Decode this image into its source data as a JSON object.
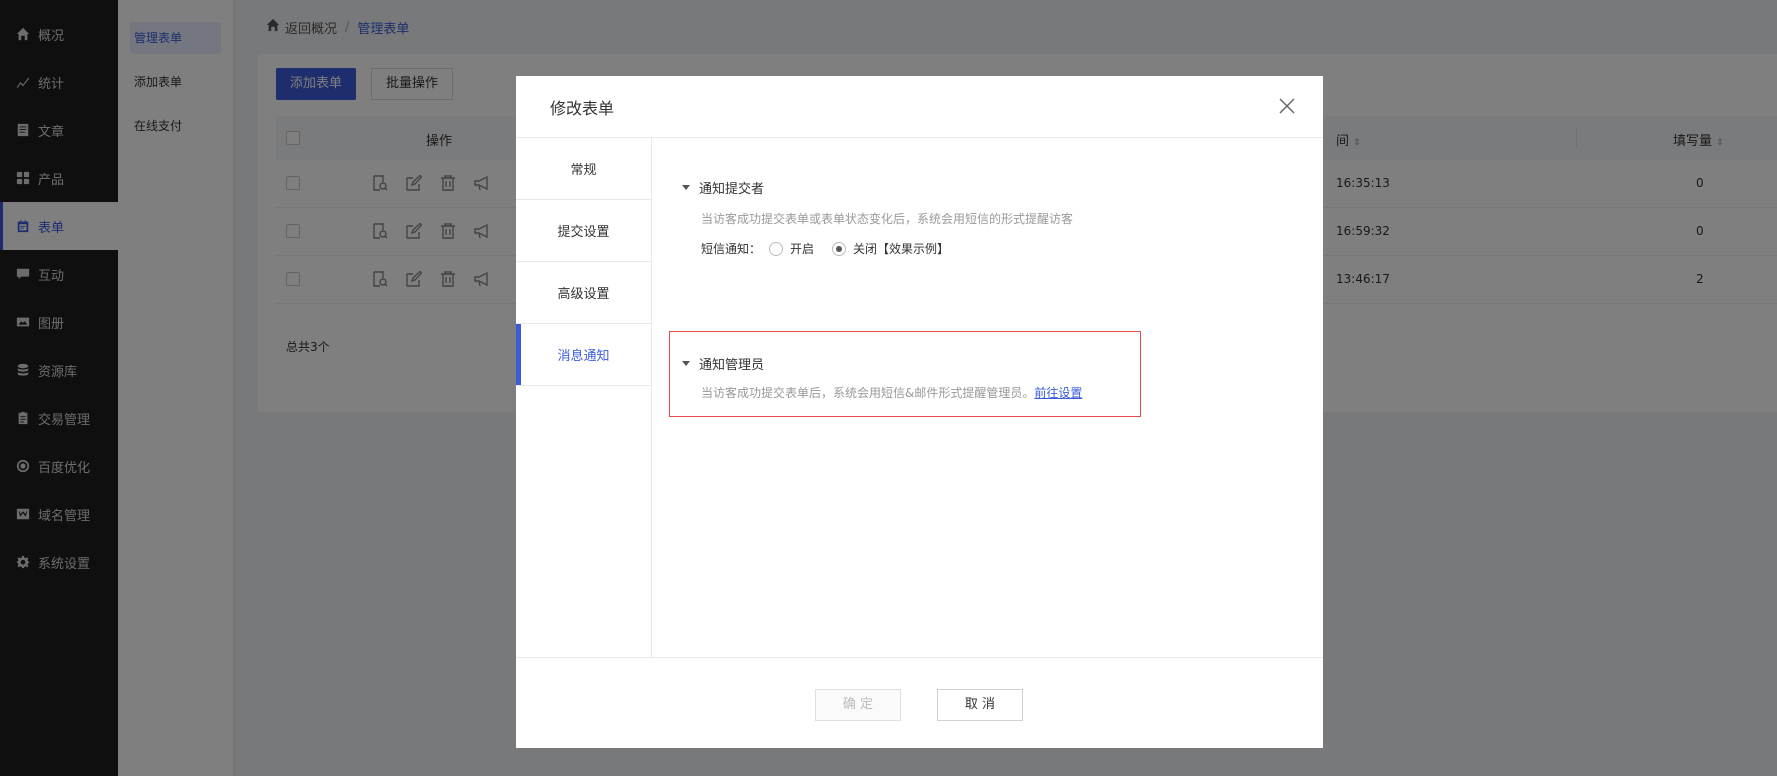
{
  "sidebar": {
    "items": [
      {
        "label": "概况",
        "icon": "home-icon"
      },
      {
        "label": "统计",
        "icon": "chart-icon"
      },
      {
        "label": "文章",
        "icon": "article-icon"
      },
      {
        "label": "产品",
        "icon": "product-icon"
      },
      {
        "label": "表单",
        "icon": "form-icon",
        "active": true
      },
      {
        "label": "互动",
        "icon": "comment-icon"
      },
      {
        "label": "图册",
        "icon": "gallery-icon"
      },
      {
        "label": "资源库",
        "icon": "database-icon"
      },
      {
        "label": "交易管理",
        "icon": "clipboard-icon"
      },
      {
        "label": "百度优化",
        "icon": "seo-icon"
      },
      {
        "label": "域名管理",
        "icon": "domain-icon"
      },
      {
        "label": "系统设置",
        "icon": "gear-icon"
      }
    ]
  },
  "subnav": {
    "items": [
      {
        "label": "管理表单",
        "active": true
      },
      {
        "label": "添加表单"
      },
      {
        "label": "在线支付"
      }
    ]
  },
  "breadcrumb": {
    "back": "返回概况",
    "sep": "/",
    "current": "管理表单"
  },
  "toolbar": {
    "add_label": "添加表单",
    "batch_label": "批量操作"
  },
  "table": {
    "headers": {
      "op": "操作",
      "time": "间",
      "count": "填写量"
    },
    "rows": [
      {
        "time": "16:35:13",
        "count": "0"
      },
      {
        "time": "16:59:32",
        "count": "0"
      },
      {
        "time": "13:46:17",
        "count": "2"
      }
    ],
    "total": "总共3个"
  },
  "modal": {
    "title": "修改表单",
    "tabs": [
      {
        "label": "常规"
      },
      {
        "label": "提交设置"
      },
      {
        "label": "高级设置"
      },
      {
        "label": "消息通知",
        "active": true
      }
    ],
    "notify_submitter": {
      "title": "通知提交者",
      "desc": "当访客成功提交表单或表单状态变化后，系统会用短信的形式提醒访客",
      "sms_label": "短信通知：",
      "option_on": "开启",
      "option_off": "关闭",
      "example": "【效果示例】",
      "selected": "关闭"
    },
    "notify_admin": {
      "title": "通知管理员",
      "desc": "当访客成功提交表单后，系统会用短信&邮件形式提醒管理员。",
      "link": "前往设置"
    },
    "ok_label": "确 定",
    "cancel_label": "取 消"
  },
  "colors": {
    "accent": "#3b5bdb",
    "highlight_border": "#e94b4b",
    "sidebar_bg": "#1f1f1f"
  }
}
